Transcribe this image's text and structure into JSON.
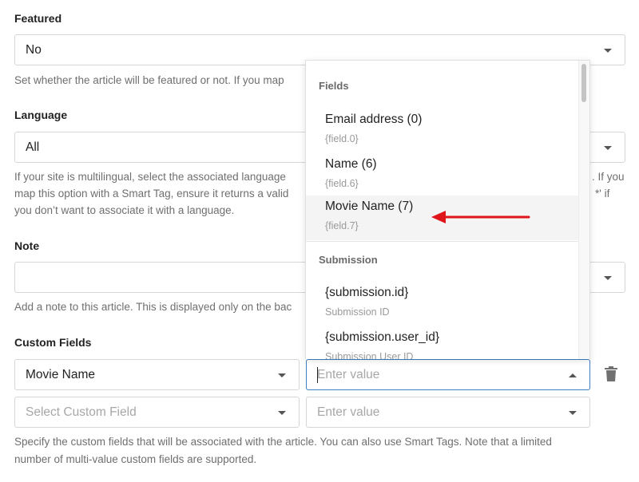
{
  "featured": {
    "label": "Featured",
    "value": "No",
    "help": "Set whether the article will be featured or not. If you map"
  },
  "language": {
    "label": "Language",
    "value": "All",
    "help_line1": "If your site is multilingual, select the associated language",
    "help_line2": "map this option with a Smart Tag, ensure it returns a valid",
    "help_line3": "you don’t want to associate it with a language.",
    "help_right1": ". If you",
    "help_right2": "*' if"
  },
  "note": {
    "label": "Note",
    "value": "",
    "help": "Add a note to this article. This is displayed only on the bac"
  },
  "custom_fields": {
    "label": "Custom Fields",
    "row1_field": "Movie Name",
    "row1_value_placeholder": "Enter value",
    "row2_field_placeholder": "Select Custom Field",
    "row2_value_placeholder": "Enter value",
    "help_line1": "Specify the custom fields that will be associated with the article. You can also use Smart Tags. Note that a limited",
    "help_line2": "number of multi-value custom fields are supported."
  },
  "dropdown": {
    "group_fields": "Fields",
    "options": [
      {
        "name": "Email address (0)",
        "tag": "{field.0}"
      },
      {
        "name": "Name (6)",
        "tag": "{field.6}"
      },
      {
        "name": "Movie Name (7)",
        "tag": "{field.7}"
      }
    ],
    "group_submission": "Submission",
    "submission_options": [
      {
        "name": "{submission.id}",
        "tag": "Submission ID"
      },
      {
        "name": "{submission.user_id}",
        "tag": "Submission User ID"
      }
    ]
  },
  "colors": {
    "focus_border": "#3d7fc4",
    "annotation_arrow": "#e0141b",
    "hover_bg": "#f4f4f4"
  },
  "icons": {
    "delete": "trash-icon",
    "select": "chevron-down-icon"
  }
}
